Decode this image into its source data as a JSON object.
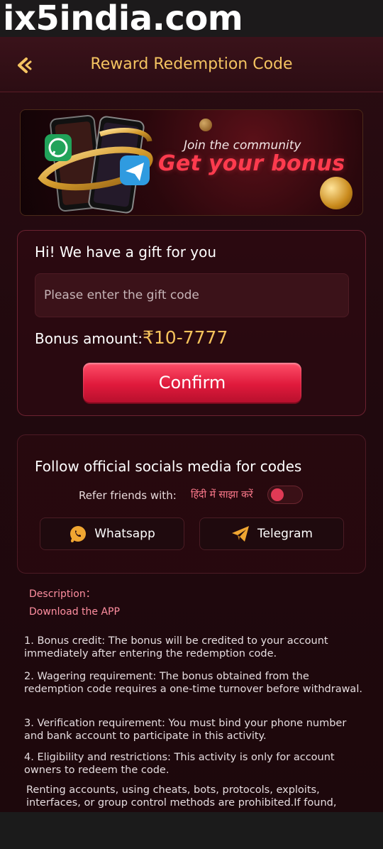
{
  "watermark": "ix5india.com",
  "header": {
    "title": "Reward Redemption Code"
  },
  "banner": {
    "join_text": "Join the community",
    "bonus_text": "Get your bonus"
  },
  "gift": {
    "title": "Hi! We have a gift for you",
    "input_placeholder": "Please enter the gift code",
    "input_value": "",
    "bonus_label": "Bonus amount:",
    "bonus_value": "₹10-7777",
    "confirm_label": "Confirm"
  },
  "social": {
    "title": "Follow official socials media for codes",
    "refer_label": "Refer friends with:",
    "hindi_label": "हिंदी में साझा करें",
    "toggle_on": false,
    "whatsapp_label": "Whatsapp",
    "telegram_label": "Telegram"
  },
  "description": {
    "label": "Description：",
    "download_label": "Download the APP",
    "rules": [
      "1. Bonus credit: The bonus will be credited to your account immediately after entering the redemption code.",
      "2. Wagering requirement: The bonus obtained from the redemption code requires a one-time turnover before withdrawal.",
      "3. Verification requirement: You must bind your phone number and bank account to participate in this activity.",
      "4. Eligibility and restrictions: This activity is only for account owners to redeem the code.",
      "Renting accounts, using cheats, bots, protocols, exploits, interfaces, or group control methods are prohibited.If found,"
    ]
  },
  "colors": {
    "accent_gold": "#f4c361",
    "accent_red": "#e01a3c",
    "link_pink": "#ff8ea0",
    "background": "#21090e"
  }
}
